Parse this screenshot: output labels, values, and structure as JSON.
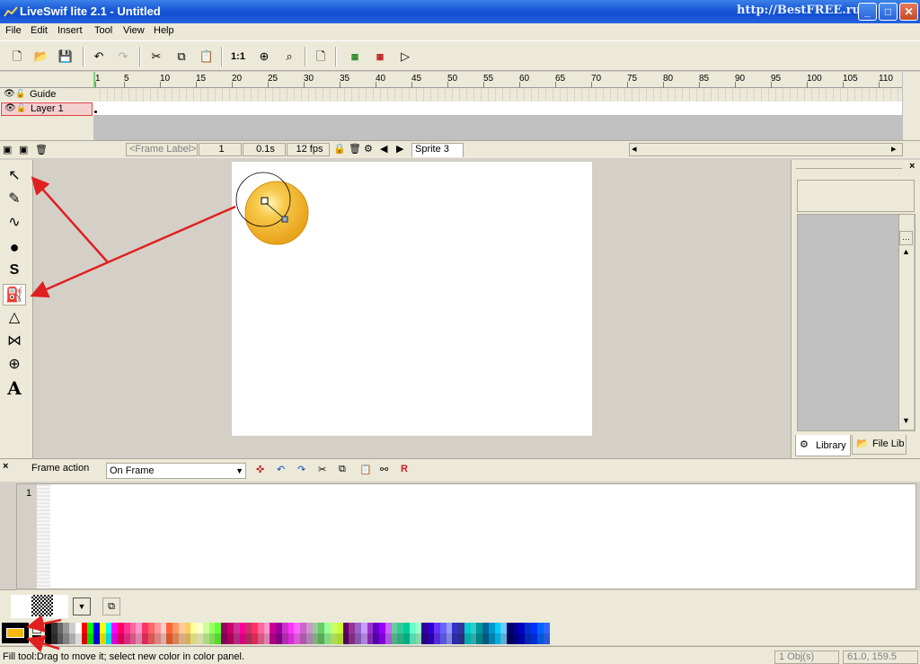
{
  "window": {
    "title": "LiveSwif lite 2.1  - Untitled",
    "watermark": "http://BestFREE.ru",
    "minimize": "_",
    "maximize": "□",
    "close": "✕"
  },
  "menu": [
    "File",
    "Edit",
    "Insert",
    "Tool",
    "View",
    "Help"
  ],
  "toolbar": {
    "zoom_label": "1:1"
  },
  "timeline": {
    "ruler": [
      "1",
      "5",
      "10",
      "15",
      "20",
      "25",
      "30",
      "35",
      "40",
      "45",
      "50",
      "55",
      "60",
      "65",
      "70",
      "75",
      "80",
      "85",
      "90",
      "95",
      "100",
      "105",
      "110"
    ],
    "layers": [
      {
        "name": "Guide"
      },
      {
        "name": "Layer 1"
      }
    ],
    "frame_label_placeholder": "<Frame Label>",
    "frame_number": "1",
    "frame_time": "0.1s",
    "fps": "12 fps",
    "sprite_tab": "Sprite 3"
  },
  "right_panel": {
    "tabs": [
      "Library",
      "File Lib"
    ]
  },
  "action_panel": {
    "title": "Frame action",
    "event_select": "On Frame",
    "line_number": "1"
  },
  "status": {
    "message": "Fill tool:Drag to move it; select new color in color panel.",
    "objects": "1 Obj(s)",
    "coords": "61.0, 159.5"
  },
  "colors": {
    "accent": "#0f4fd0",
    "fill_swatch": "#f5b800",
    "annotation_arrow": "#e02020",
    "circle_fill": "#f0b429"
  },
  "palette": [
    "#000000",
    "#333333",
    "#666666",
    "#999999",
    "#cccccc",
    "#ffffff",
    "#ff0000",
    "#00ff00",
    "#0000ff",
    "#ffff00",
    "#00ffff",
    "#ff00ff",
    "#ff0066",
    "#ff3399",
    "#ff6699",
    "#ff99cc",
    "#ff3366",
    "#ff6666",
    "#ff9999",
    "#ffcccc",
    "#ff6633",
    "#ff9966",
    "#ffcc99",
    "#ffcc66",
    "#ffff99",
    "#ffffcc",
    "#ccff99",
    "#99ff66",
    "#66ff33",
    "#990066",
    "#cc0066",
    "#cc3399",
    "#ff0099",
    "#cc3366",
    "#ff3366",
    "#ff6699",
    "#ff99cc",
    "#cc0099",
    "#990099",
    "#cc33cc",
    "#ff33ff",
    "#ff66ff",
    "#cc66cc",
    "#cc99cc",
    "#99cc99",
    "#66cc66",
    "#99ff99",
    "#ccff66",
    "#ccff33",
    "#660066",
    "#993399",
    "#9966cc",
    "#cc99ff",
    "#9933cc",
    "#6600cc",
    "#9900ff",
    "#cc66ff",
    "#66cc99",
    "#33cc99",
    "#00cc99",
    "#66ffcc",
    "#99ffcc",
    "#330099",
    "#3300cc",
    "#6633ff",
    "#6666ff",
    "#9999ff",
    "#3333cc",
    "#333399",
    "#00cccc",
    "#33cccc",
    "#009999",
    "#006699",
    "#0099cc",
    "#00ccff",
    "#66ccff",
    "#000066",
    "#000099",
    "#0000cc",
    "#0033cc",
    "#0033ff",
    "#0066ff",
    "#3366ff"
  ]
}
